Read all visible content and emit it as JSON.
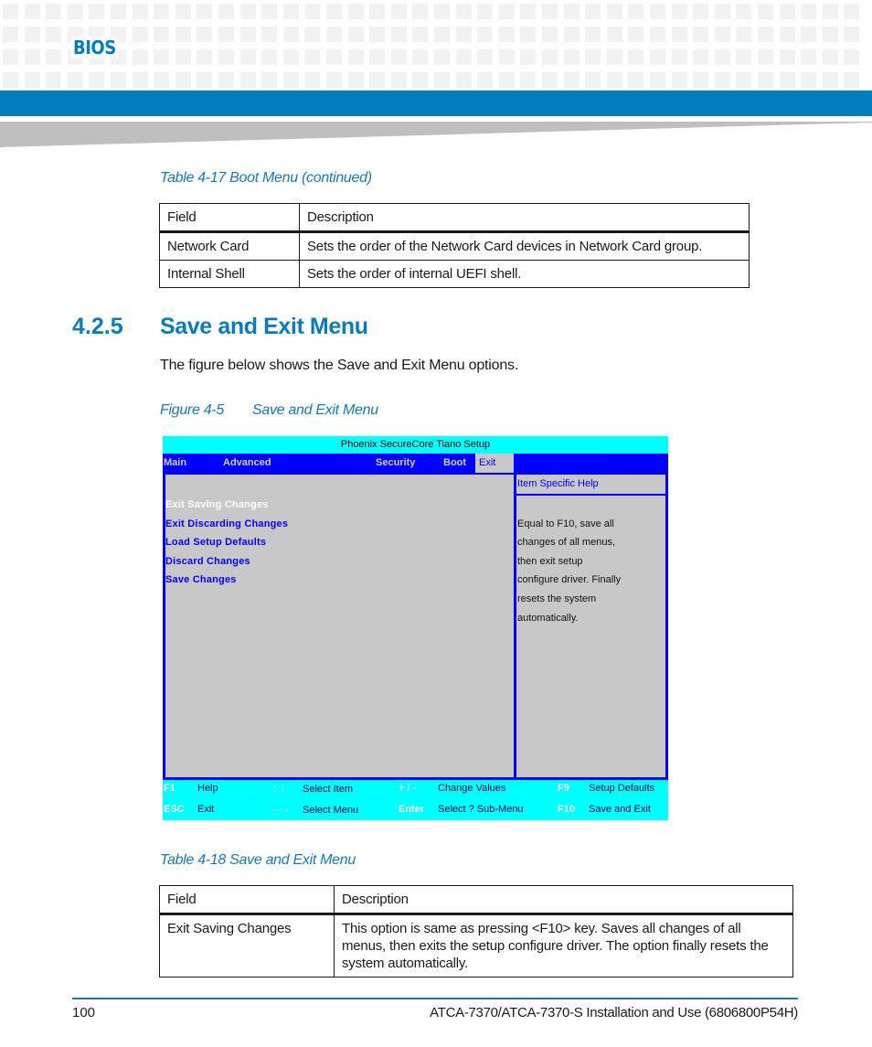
{
  "header": {
    "section_label": "BIOS"
  },
  "table_4_17": {
    "caption": "Table 4-17 Boot Menu  (continued)",
    "columns": [
      "Field",
      "Description"
    ],
    "rows": [
      [
        "Network Card",
        "Sets the order of the Network Card devices in Network Card group."
      ],
      [
        "Internal Shell",
        "Sets the order of internal UEFI shell."
      ]
    ]
  },
  "section": {
    "number": "4.2.5",
    "title": "Save and Exit Menu",
    "intro": "The figure below shows the Save and Exit Menu options."
  },
  "figure": {
    "caption_num": "Figure 4-5",
    "caption_title": "Save and Exit Menu",
    "bios": {
      "title": "Phoenix SecureCore Tiano Setup",
      "menu": [
        "Main",
        "Advanced",
        "Security",
        "Boot",
        "Exit"
      ],
      "active_menu": "Exit",
      "options": [
        "Exit Saving Changes",
        "Exit Discarding Changes",
        "Load Setup Defaults",
        "Discard Changes",
        "Save Changes"
      ],
      "selected_option": "Exit Saving Changes",
      "help_title": "Item Specific Help",
      "help_lines": [
        "Equal to F10, save all",
        "changes of all menus,",
        "then exit setup",
        "configure driver. Finally",
        "resets the system",
        "automatically."
      ],
      "footer": [
        {
          "key": "F1",
          "desc": "Help"
        },
        {
          "key": "ESC",
          "desc": "Exit"
        },
        {
          "key": "↑ ↓",
          "desc": "Select Item"
        },
        {
          "key": "←→",
          "desc": "Select Menu"
        },
        {
          "key": "+ / -",
          "desc": "Change Values"
        },
        {
          "key": "Enter",
          "desc": "Select ?  Sub-Menu"
        },
        {
          "key": "F9",
          "desc": "Setup Defaults"
        },
        {
          "key": "F10",
          "desc": "Save and Exit"
        }
      ],
      "colors": {
        "title_bar": "#00ffff",
        "menu_bar": "#0000ff",
        "panel": "#c8c8c8",
        "option_text": "#0000ff",
        "selected_text": "#ffffff"
      }
    }
  },
  "table_4_18": {
    "caption": "Table 4-18 Save and Exit Menu",
    "columns": [
      "Field",
      "Description"
    ],
    "rows": [
      [
        "Exit Saving Changes",
        "This option is same as pressing <F10> key. Saves all changes of all menus, then exits the setup configure driver. The option finally resets the system automatically."
      ]
    ]
  },
  "footer": {
    "page_number": "100",
    "doc_title": "ATCA-7370/ATCA-7370-S Installation and Use (6806800P54H)"
  },
  "colors": {
    "brand_blue": "#027dbd",
    "heading_blue": "#0a7bbf"
  }
}
